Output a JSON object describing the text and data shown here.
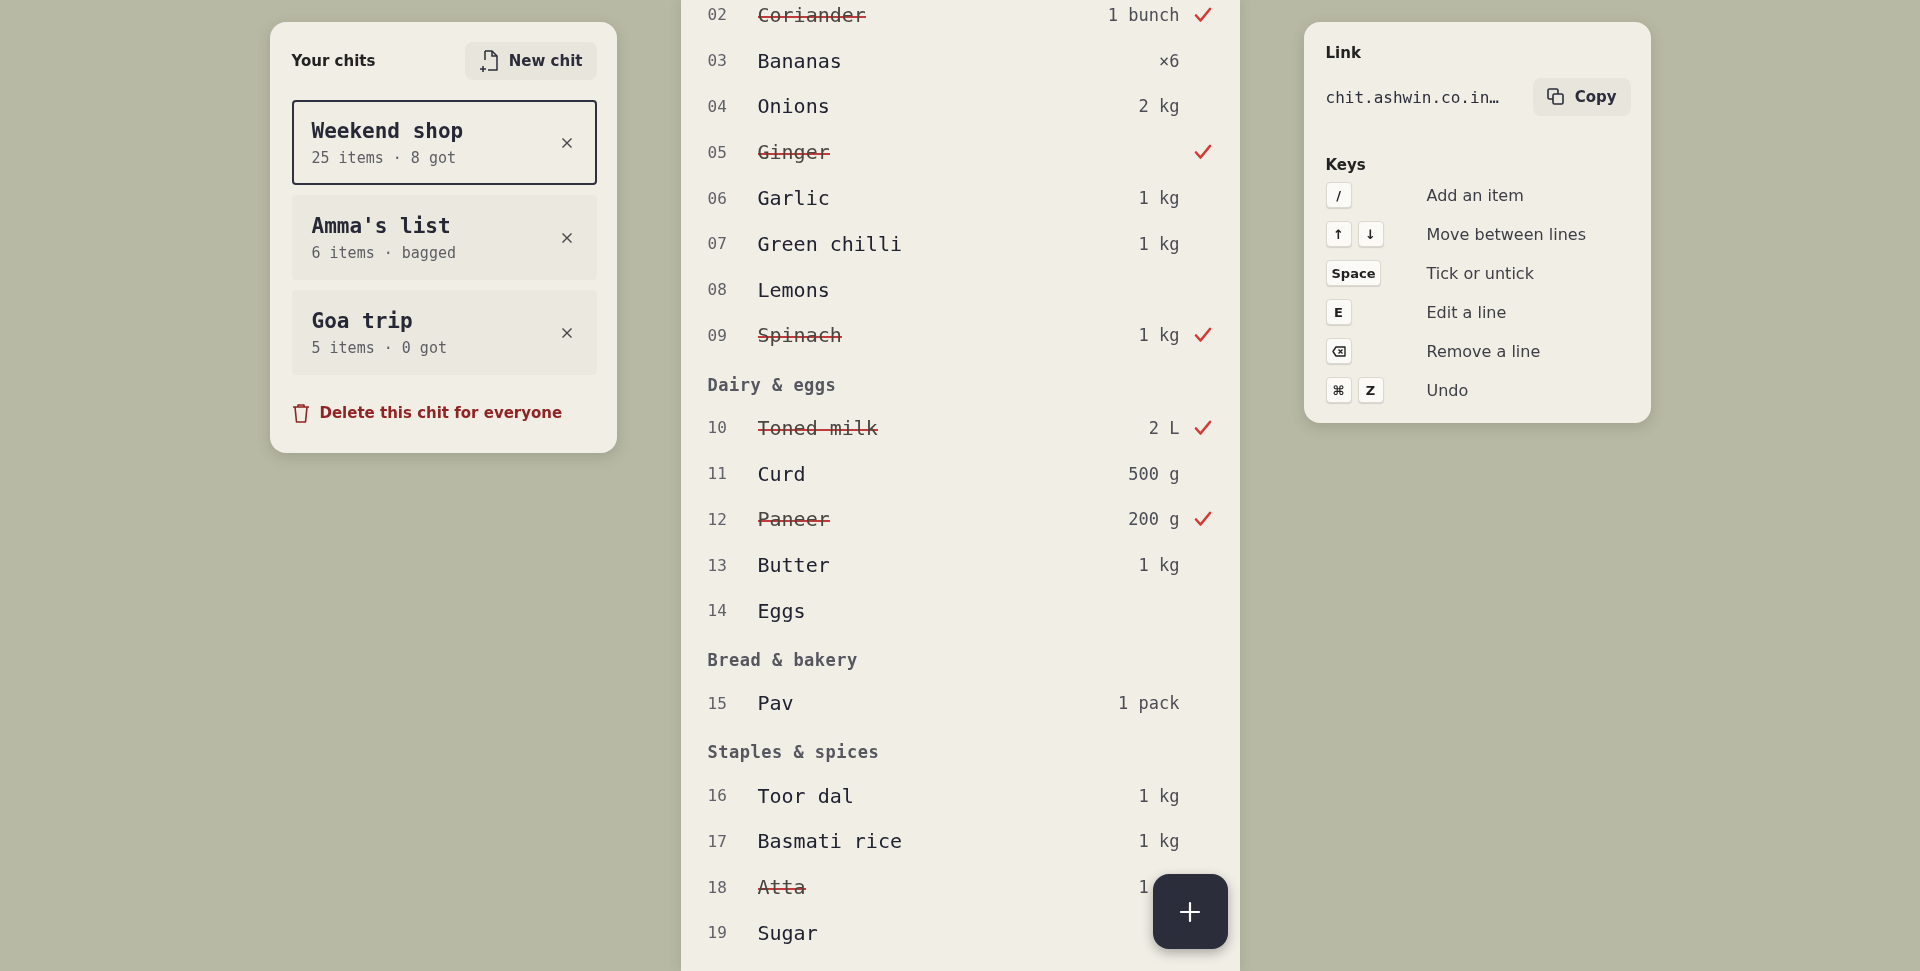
{
  "sidebar": {
    "title": "Your chits",
    "new_button": "New chit",
    "chits": [
      {
        "name": "Weekend shop",
        "summary": "25 items · 8 got",
        "selected": true
      },
      {
        "name": "Amma's list",
        "summary": "6 items · bagged",
        "selected": false
      },
      {
        "name": "Goa trip",
        "summary": "5 items · 0 got",
        "selected": false
      }
    ],
    "delete_link": "Delete this chit for everyone"
  },
  "list": {
    "lines": [
      {
        "kind": "item",
        "number": "02",
        "name": "Coriander",
        "qty": "1 bunch",
        "checked": true
      },
      {
        "kind": "item",
        "number": "03",
        "name": "Bananas",
        "qty": "×6",
        "checked": false
      },
      {
        "kind": "item",
        "number": "04",
        "name": "Onions",
        "qty": "2 kg",
        "checked": false
      },
      {
        "kind": "item",
        "number": "05",
        "name": "Ginger",
        "checked": true
      },
      {
        "kind": "item",
        "number": "06",
        "name": "Garlic",
        "qty": "1 kg",
        "checked": false
      },
      {
        "kind": "item",
        "number": "07",
        "name": "Green chilli",
        "qty": "1 kg",
        "checked": false
      },
      {
        "kind": "item",
        "number": "08",
        "name": "Lemons",
        "checked": false
      },
      {
        "kind": "item",
        "number": "09",
        "name": "Spinach",
        "qty": "1 kg",
        "checked": true
      },
      {
        "kind": "heading",
        "label": "Dairy & eggs"
      },
      {
        "kind": "item",
        "number": "10",
        "name": "Toned milk",
        "qty": "2 L",
        "checked": true
      },
      {
        "kind": "item",
        "number": "11",
        "name": "Curd",
        "qty": "500 g",
        "checked": false
      },
      {
        "kind": "item",
        "number": "12",
        "name": "Paneer",
        "qty": "200 g",
        "checked": true
      },
      {
        "kind": "item",
        "number": "13",
        "name": "Butter",
        "qty": "1 kg",
        "checked": false
      },
      {
        "kind": "item",
        "number": "14",
        "name": "Eggs",
        "checked": false
      },
      {
        "kind": "heading",
        "label": "Bread & bakery"
      },
      {
        "kind": "item",
        "number": "15",
        "name": "Pav",
        "qty": "1 pack",
        "checked": false
      },
      {
        "kind": "heading",
        "label": "Staples & spices"
      },
      {
        "kind": "item",
        "number": "16",
        "name": "Toor dal",
        "qty": "1 kg",
        "checked": false
      },
      {
        "kind": "item",
        "number": "17",
        "name": "Basmati rice",
        "qty": "1 kg",
        "checked": false
      },
      {
        "kind": "item",
        "number": "18",
        "name": "Atta",
        "qty": "1",
        "qty_cut": true,
        "checked": true
      },
      {
        "kind": "item",
        "number": "19",
        "name": "Sugar",
        "checked": false
      }
    ]
  },
  "share": {
    "title": "Link",
    "url": "chit.ashwin.co.in…",
    "copy_button": "Copy"
  },
  "keys": {
    "title": "Keys",
    "shortcuts": [
      {
        "keys": [
          {
            "kind": "text",
            "label": "/"
          }
        ],
        "action": "Add an item"
      },
      {
        "keys": [
          {
            "kind": "text",
            "label": "↑"
          },
          {
            "kind": "text",
            "label": "↓"
          }
        ],
        "action": "Move between lines"
      },
      {
        "keys": [
          {
            "kind": "text",
            "label": "Space"
          }
        ],
        "action": "Tick or untick"
      },
      {
        "keys": [
          {
            "kind": "text",
            "label": "E"
          }
        ],
        "action": "Edit a line"
      },
      {
        "keys": [
          {
            "kind": "backspace"
          }
        ],
        "action": "Remove a line"
      },
      {
        "keys": [
          {
            "kind": "text",
            "label": "⌘"
          },
          {
            "kind": "text",
            "label": "Z"
          }
        ],
        "action": "Undo"
      }
    ]
  }
}
